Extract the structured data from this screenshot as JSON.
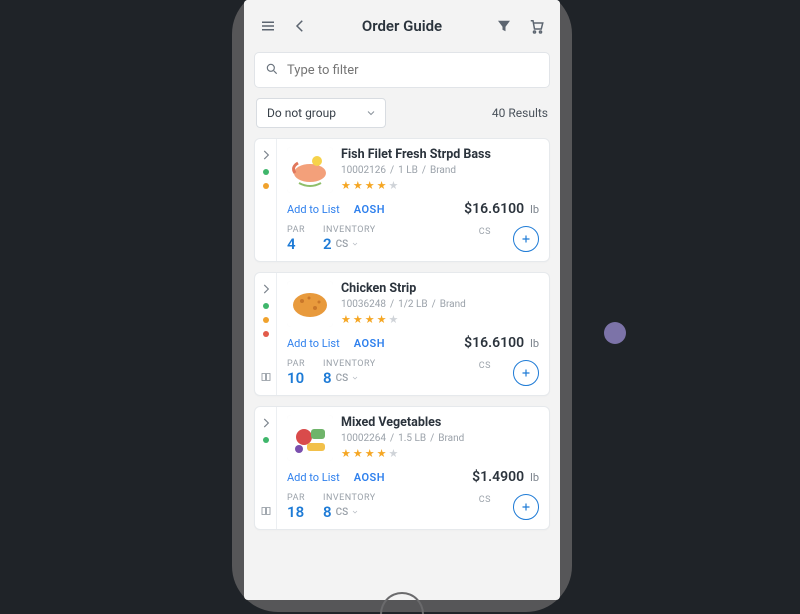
{
  "header": {
    "title": "Order Guide"
  },
  "search": {
    "placeholder": "Type to filter"
  },
  "group": {
    "selected": "Do not group"
  },
  "results_label": "40 Results",
  "labels": {
    "add_to_list": "Add to List",
    "aosh": "AOSH",
    "par": "PAR",
    "inventory": "INVENTORY",
    "inv_unit": "CS",
    "cs": "CS"
  },
  "dot_colors": {
    "green": "#3fb66b",
    "amber": "#f0a22d",
    "red": "#e25b4a"
  },
  "items": [
    {
      "name": "Fish Filet Fresh Strpd Bass",
      "sku": "10002126",
      "size": "1 LB",
      "brand": "Brand",
      "stars": 4,
      "price": "$16.6100",
      "unit": "lb",
      "par": "4",
      "inventory": "2",
      "dots": [
        "green",
        "amber"
      ],
      "book": false,
      "thumb": "fish"
    },
    {
      "name": "Chicken Strip",
      "sku": "10036248",
      "size": "1/2 LB",
      "brand": "Brand",
      "stars": 4,
      "price": "$16.6100",
      "unit": "lb",
      "par": "10",
      "inventory": "8",
      "dots": [
        "green",
        "amber",
        "red"
      ],
      "book": true,
      "thumb": "chicken"
    },
    {
      "name": "Mixed Vegetables",
      "sku": "10002264",
      "size": "1.5 LB",
      "brand": "Brand",
      "stars": 4,
      "price": "$1.4900",
      "unit": "lb",
      "par": "18",
      "inventory": "8",
      "dots": [
        "green"
      ],
      "book": true,
      "thumb": "veg"
    }
  ]
}
